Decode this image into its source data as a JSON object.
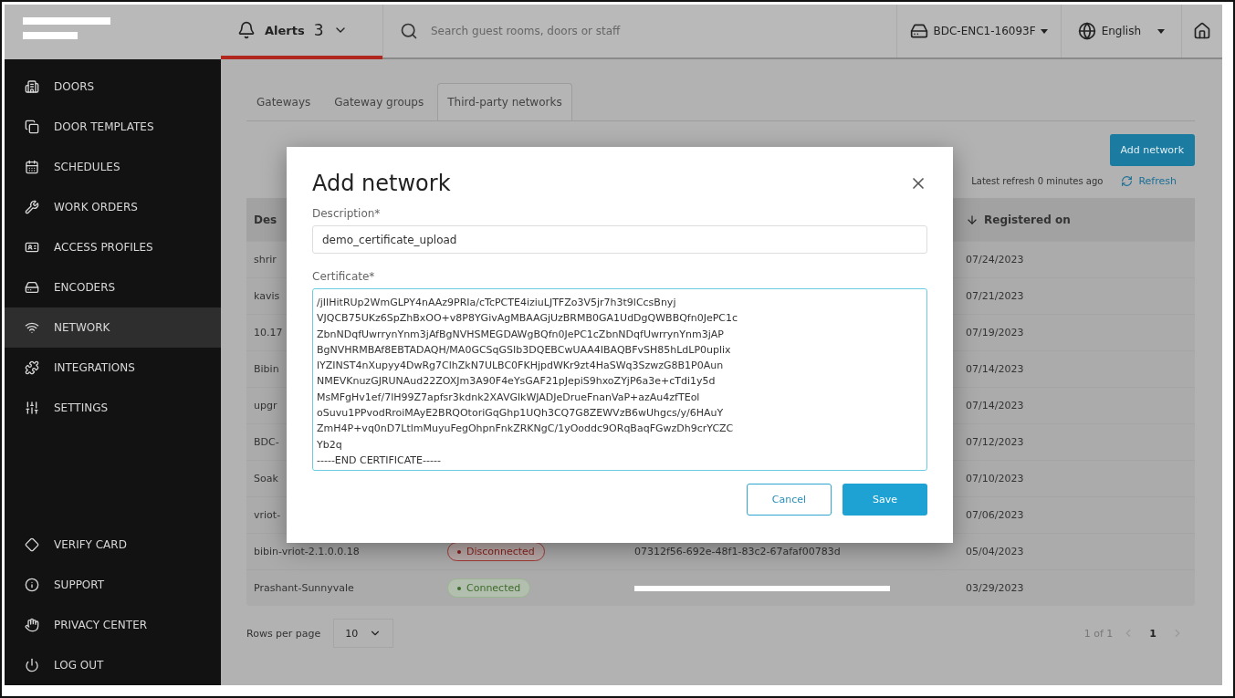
{
  "sidebar": {
    "items": [
      {
        "label": "DOORS",
        "selected": false
      },
      {
        "label": "DOOR TEMPLATES",
        "selected": false
      },
      {
        "label": "SCHEDULES",
        "selected": false
      },
      {
        "label": "WORK ORDERS",
        "selected": false
      },
      {
        "label": "ACCESS PROFILES",
        "selected": false
      },
      {
        "label": "ENCODERS",
        "selected": false
      },
      {
        "label": "NETWORK",
        "selected": true
      },
      {
        "label": "INTEGRATIONS",
        "selected": false
      },
      {
        "label": "SETTINGS",
        "selected": false
      }
    ],
    "bottom_items": [
      {
        "label": "VERIFY CARD",
        "selected": false
      },
      {
        "label": "SUPPORT",
        "selected": false
      },
      {
        "label": "PRIVACY CENTER",
        "selected": false
      },
      {
        "label": "LOG OUT",
        "selected": false
      }
    ]
  },
  "header": {
    "alerts_label": "Alerts",
    "alerts_count": "3",
    "search": {
      "placeholder": "Search guest rooms, doors or staff"
    },
    "encoder": "BDC-ENC1-16093F",
    "language": "English"
  },
  "tabs": [
    {
      "label": "Gateways",
      "selected": false
    },
    {
      "label": "Gateway groups",
      "selected": false
    },
    {
      "label": "Third-party networks",
      "selected": true
    }
  ],
  "add_button": "Add network",
  "latest_refresh": "Latest refresh 0 minutes ago",
  "refresh_link": "Refresh",
  "table": {
    "columns": [
      "Des",
      "Registered on"
    ],
    "rows": [
      {
        "description": "shrir",
        "registered": "07/24/2023"
      },
      {
        "description": "kavis",
        "registered": "07/21/2023"
      },
      {
        "description": "10.17",
        "registered": "07/19/2023"
      },
      {
        "description": "Bibin",
        "registered": "07/14/2023"
      },
      {
        "description": "upgr",
        "registered": "07/14/2023"
      },
      {
        "description": "BDC-",
        "registered": "07/12/2023"
      },
      {
        "description": "Soak",
        "registered": "07/10/2023"
      },
      {
        "description": "vriot-",
        "registered": "07/06/2023"
      },
      {
        "description": "bibin-vriot-2.1.0.0.18",
        "status": "Disconnected",
        "connected": false,
        "id": "07312f56-692e-48f1-83c2-67afaf00783d",
        "registered": "05/04/2023"
      },
      {
        "description": "Prashant-Sunnyvale",
        "status": "Connected",
        "connected": true,
        "id_redacted": true,
        "registered": "03/29/2023"
      }
    ]
  },
  "pagination": {
    "rows_label": "Rows per page",
    "rows_value": "10",
    "range": "1 of 1",
    "page": "1"
  },
  "modal": {
    "title": "Add network",
    "description_label": "Description*",
    "description_value": "demo_certificate_upload",
    "certificate_label": "Certificate*",
    "certificate_value": "/jIIHitRUp2WmGLPY4nAAz9PRIa/cTcPCTE4iziuLJTFZo3V5jr7h3t9lCcsBnyj\nVJQCB75UKz6SpZhBxOO+v8P8YGivAgMBAAGjUzBRMB0GA1UdDgQWBBQfn0JePC1c\nZbnNDqfUwrrynYnm3jAfBgNVHSMEGDAWgBQfn0JePC1cZbnNDqfUwrrynYnm3jAP\nBgNVHRMBAf8EBTADAQH/MA0GCSqGSIb3DQEBCwUAA4IBAQBFvSH85hLdLP0uplix\nlYZINST4nXupyy4DwRg7ClhZkN7ULBC0FKHjpdWKr9zt4HaSWq3SzwzG8B1P0Aun\nNMEVKnuzGJRUNAud22ZOXJm3A90F4eYsGAF21pJepiS9hxoZYjP6a3e+cTdi1y5d\nMsMFgHv1ef/7lH99Z7apfsr3kdnk2XAVGlkWJADJeDrueFnanVaP+azAu4zfTEol\noSuvu1PPvodRroiMAyE2BRQOtoriGqGhp1UQh3CQ7G8ZEWVzB6wUhgcs/y/6HAuY\nZmH4P+vq0nD7LtlmMuyuFegOhpnFnkZRKNgC/1yOoddc9ORqBaqFGwzDh9crYCZC\nYb2q\n-----END CERTIFICATE-----",
    "cancel": "Cancel",
    "save": "Save"
  }
}
